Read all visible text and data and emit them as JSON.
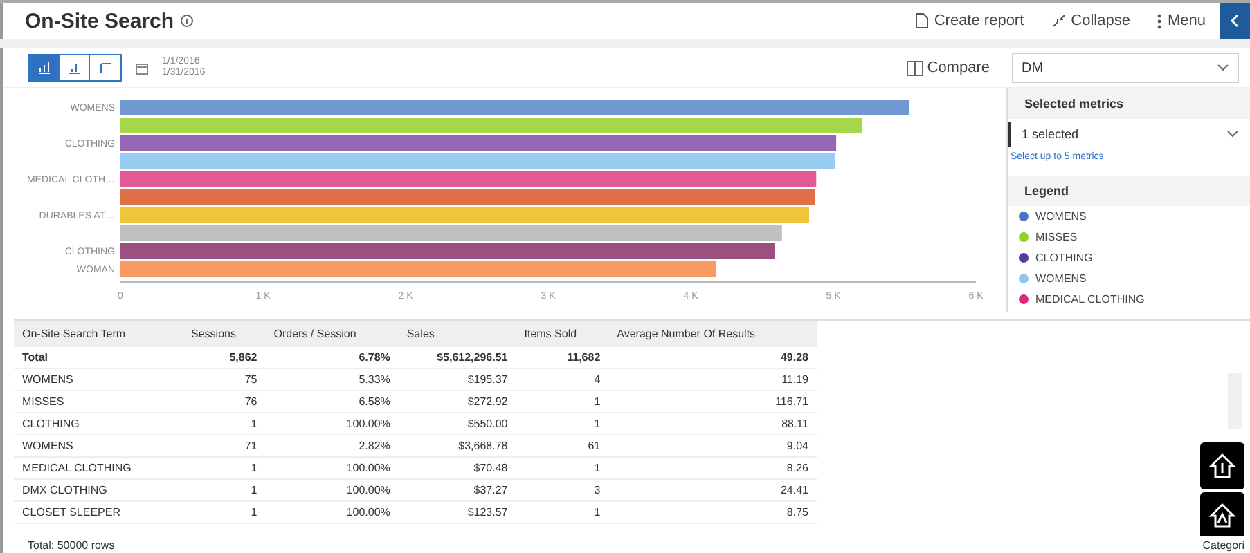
{
  "header": {
    "title": "On-Site Search",
    "actions": [
      {
        "kind": "report",
        "label": "Create report"
      },
      {
        "kind": "collapse",
        "label": "Collapse"
      },
      {
        "kind": "menu",
        "label": "Menu"
      }
    ]
  },
  "view_toggles": [
    {
      "kind": "bar",
      "selected": true
    },
    {
      "kind": "column",
      "selected": false
    },
    {
      "kind": "line",
      "selected": false
    }
  ],
  "date_range": [
    "1/1/2016",
    "1/31/2016"
  ],
  "compare": {
    "label": "Compare",
    "value": "DM"
  },
  "chart_data": {
    "type": "bar",
    "orientation": "horizontal",
    "categories": [
      "WOMENS",
      null,
      "CLOTHING",
      null,
      "MEDICAL CLOTH…",
      null,
      "DURABLES AT…",
      null,
      "CLOTHING",
      "WOMAN"
    ],
    "colors": [
      "#6f97d0",
      "#a6d64a",
      "#9367b3",
      "#99ccf3",
      "#e45a98",
      "#e07048",
      "#f0c63c",
      "#c0c0c0",
      "#9b5080",
      "#f79a64"
    ],
    "values": [
      5.53,
      5.2,
      5.02,
      5.01,
      4.88,
      4.87,
      4.83,
      4.64,
      4.59,
      4.18
    ],
    "xlim": [
      0,
      6
    ],
    "xticks": [
      {
        "value": 0,
        "label": "0"
      },
      {
        "value": 1,
        "label": "1 K"
      },
      {
        "value": 2,
        "label": "2 K"
      },
      {
        "value": 3,
        "label": "3 K"
      },
      {
        "value": 4,
        "label": "4 K"
      },
      {
        "value": 5,
        "label": "5 K"
      },
      {
        "value": 6,
        "label": "6 K"
      }
    ]
  },
  "metrics": {
    "title": "Selected metrics",
    "value": "1 selected",
    "hint": "Select up to 5 metrics"
  },
  "legend": {
    "title": "Legend",
    "items": [
      {
        "label": "WOMENS",
        "color": "#4a74c4"
      },
      {
        "label": "MISSES",
        "color": "#8fd12a"
      },
      {
        "label": "CLOTHING",
        "color": "#5b3a94"
      },
      {
        "label": "WOMENS",
        "color": "#8cc6f0"
      },
      {
        "label": "MEDICAL CLOTHING",
        "color": "#e0287a"
      }
    ]
  },
  "table": {
    "columns": [
      "On-Site Search Term",
      "Sessions",
      "Orders / Session",
      "Sales",
      "Items Sold",
      "Average Number Of Results"
    ],
    "rows": [
      {
        "total": true,
        "cells": [
          "Total",
          "5,862",
          "6.78%",
          "$5,612,296.51",
          "11,682",
          "49.28"
        ]
      },
      {
        "total": false,
        "cells": [
          "WOMENS",
          "75",
          "5.33%",
          "$195.37",
          "4",
          "11.19"
        ]
      },
      {
        "total": false,
        "cells": [
          "MISSES",
          "76",
          "6.58%",
          "$272.92",
          "1",
          "116.71"
        ]
      },
      {
        "total": false,
        "cells": [
          "CLOTHING",
          "1",
          "100.00%",
          "$550.00",
          "1",
          "88.11"
        ]
      },
      {
        "total": false,
        "cells": [
          "WOMENS",
          "71",
          "2.82%",
          "$3,668.78",
          "61",
          "9.04"
        ]
      },
      {
        "total": false,
        "cells": [
          "MEDICAL CLOTHING",
          "1",
          "100.00%",
          "$70.48",
          "1",
          "8.26"
        ]
      },
      {
        "total": false,
        "cells": [
          "DMX CLOTHING",
          "1",
          "100.00%",
          "$37.27",
          "3",
          "24.41"
        ]
      },
      {
        "total": false,
        "cells": [
          "CLOSET SLEEPER",
          "1",
          "100.00%",
          "$123.57",
          "1",
          "8.75"
        ]
      }
    ]
  },
  "footer": {
    "total": "Total: 50000 rows",
    "right": "Categori"
  }
}
